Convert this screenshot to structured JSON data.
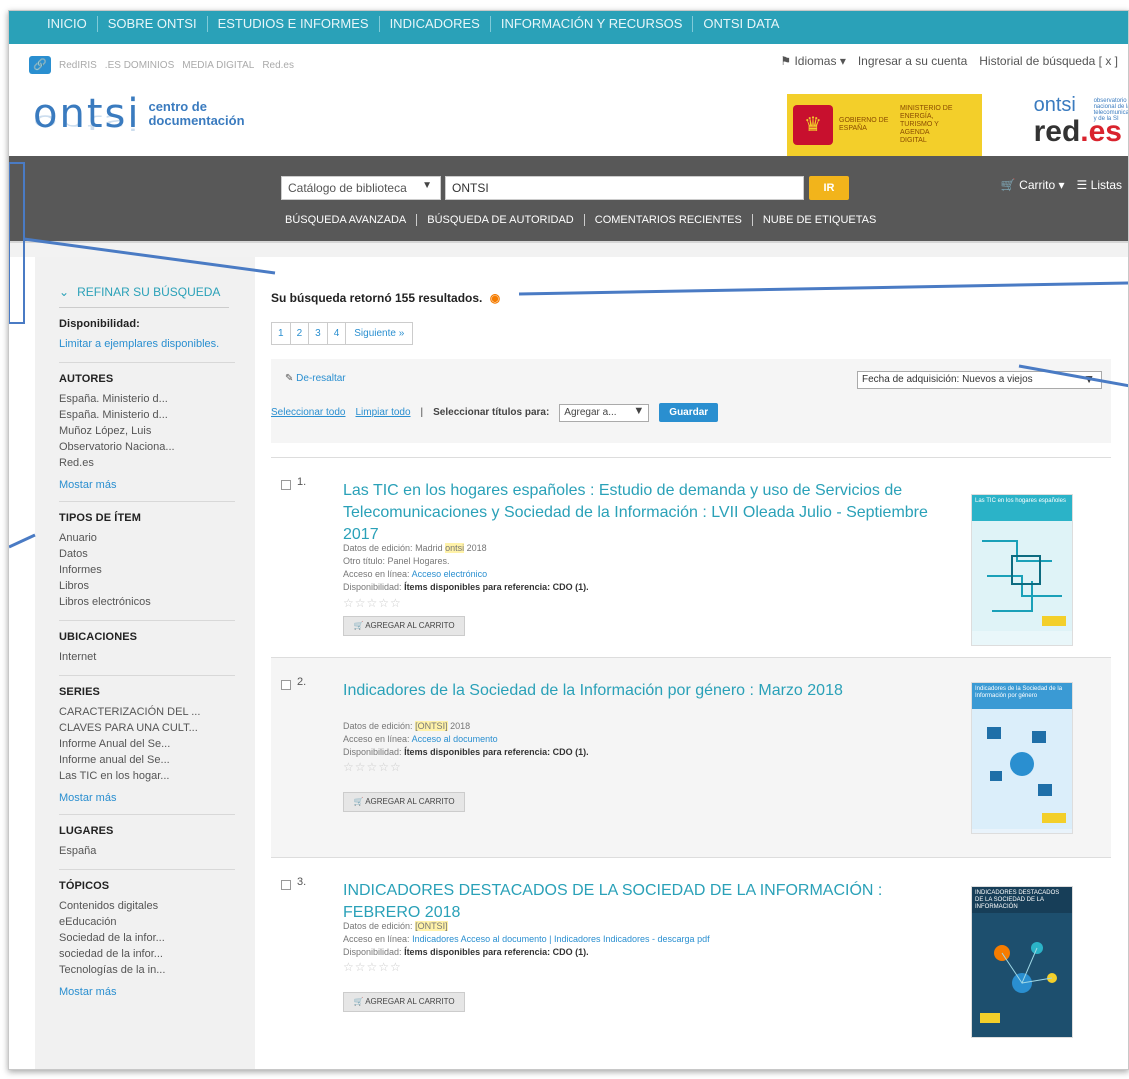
{
  "topnav": {
    "items": [
      "INICIO",
      "SOBRE ONTSI",
      "ESTUDIOS E INFORMES",
      "INDICADORES",
      "INFORMACIÓN Y RECURSOS",
      "ONTSI DATA"
    ]
  },
  "strip": {
    "mini_links": [
      "RedIRIS",
      ".ES DOMINIOS",
      "MEDIA DIGITAL",
      "Red.es"
    ],
    "languages": "Idiomas",
    "login": "Ingresar a su cuenta",
    "history": "Historial de búsqueda [ x ]"
  },
  "logo": {
    "word": "ontsi",
    "sub1": "centro de",
    "sub2": "documentación"
  },
  "gov": {
    "t1": "GOBIERNO DE ESPAÑA",
    "t2": "MINISTERIO DE ENERGÍA, TURISMO Y AGENDA DIGITAL"
  },
  "brand_right": {
    "ontsi": "ontsi",
    "small": "observatorio nacional de las telecomunicaciones y de la SI",
    "red": "red",
    "es": ".es"
  },
  "search": {
    "catalog": "Catálogo de biblioteca",
    "query": "ONTSI",
    "go": "IR",
    "cart": "Carrito",
    "lists": "Listas",
    "links": [
      "BÚSQUEDA AVANZADA",
      "BÚSQUEDA DE AUTORIDAD",
      "COMENTARIOS RECIENTES",
      "NUBE DE ETIQUETAS"
    ]
  },
  "sidebar": {
    "refine": "REFINAR SU BÚSQUEDA",
    "availability": {
      "title": "Disponibilidad:",
      "link": "Limitar a ejemplares disponibles."
    },
    "facets": [
      {
        "title": "AUTORES",
        "items": [
          "España. Ministerio d...",
          "España. Ministerio d...",
          "Muñoz López, Luis",
          "Observatorio Naciona...",
          "Red.es"
        ],
        "more": "Mostar más"
      },
      {
        "title": "TIPOS DE ÍTEM",
        "items": [
          "Anuario",
          "Datos",
          "Informes",
          "Libros",
          "Libros electrónicos"
        ],
        "more": ""
      },
      {
        "title": "UBICACIONES",
        "items": [
          "Internet"
        ],
        "more": ""
      },
      {
        "title": "SERIES",
        "items": [
          "CARACTERIZACIÓN DEL ...",
          "CLAVES PARA UNA CULT...",
          "Informe Anual del Se...",
          "Informe anual del Se...",
          "Las TIC en los hogar..."
        ],
        "more": "Mostar más"
      },
      {
        "title": "LUGARES",
        "items": [
          "España"
        ],
        "more": ""
      },
      {
        "title": "TÓPICOS",
        "items": [
          "Contenidos digitales",
          "eEducación",
          "Sociedad de la infor...",
          "sociedad de la infor...",
          "Tecnologías de la in..."
        ],
        "more": "Mostar más"
      }
    ]
  },
  "results": {
    "count_text": "Su búsqueda retornó 155 resultados.",
    "pages": [
      "1",
      "2",
      "3",
      "4",
      "Siguiente »"
    ],
    "dehighlight": "De-resaltar",
    "sort": "Fecha de adquisición: Nuevos a viejos",
    "select_all": "Seleccionar todo",
    "clear_all": "Limpiar todo",
    "select_titles": "Seleccionar títulos para:",
    "add_to": "Agregar a...",
    "save": "Guardar",
    "edition_label": "Datos de edición:",
    "online_label": "Acceso en línea:",
    "availability_label": "Disponibilidad:",
    "add_to_cart": "AGREGAR AL CARRITO",
    "items": [
      {
        "number": "1.",
        "title": "Las TIC en los hogares españoles : Estudio de demanda y uso de Servicios de Telecomunicaciones y Sociedad de la Información : LVII Oleada Julio - Septiembre 2017",
        "edition_pre": "Madrid",
        "edition_hl": "ontsi",
        "edition_post": "2018",
        "other_title": "Otro título: Panel Hogares.",
        "online_link": "Acceso electrónico",
        "availability": "Ítems disponibles para referencia: CDO (1).",
        "cover_title": "Las TIC en los hogares españoles",
        "cover_color": "#2bb3c8"
      },
      {
        "number": "2.",
        "title": "Indicadores de la Sociedad de la Información por género : Marzo 2018",
        "edition_pre": "",
        "edition_hl": "[ONTSI]",
        "edition_post": "2018",
        "other_title": "",
        "online_link": "Acceso al documento",
        "availability": "Ítems disponibles para referencia: CDO (1).",
        "cover_title": "Indicadores de la Sociedad de la Información por género",
        "cover_color": "#3a9ad4"
      },
      {
        "number": "3.",
        "title": "INDICADORES DESTACADOS DE LA SOCIEDAD DE LA INFORMACIÓN : FEBRERO 2018",
        "edition_pre": "",
        "edition_hl": "[ONTSI]",
        "edition_post": "",
        "other_title": "",
        "online_link": "Indicadores Acceso al documento | Indicadores Indicadores - descarga pdf",
        "availability": "Ítems disponibles para referencia: CDO (1).",
        "cover_title": "INDICADORES DESTACADOS DE LA SOCIEDAD DE LA INFORMACIÓN",
        "cover_color": "#1d4f6e"
      }
    ]
  },
  "colors": {
    "accent": "#2aa1b8",
    "link": "#2a8fd0",
    "dark": "#585858",
    "go": "#f2b41b"
  }
}
